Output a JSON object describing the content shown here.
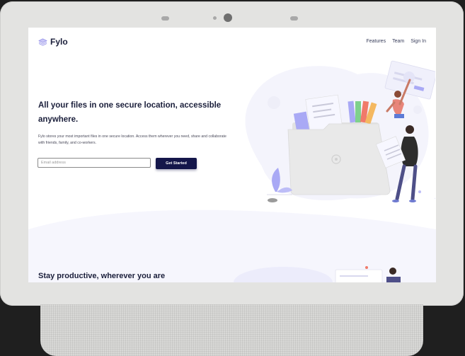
{
  "header": {
    "logo_text": "Fylo",
    "nav": [
      {
        "label": "Features"
      },
      {
        "label": "Team"
      },
      {
        "label": "Sign In"
      }
    ]
  },
  "hero": {
    "title": "All your files in one secure location, accessible anywhere.",
    "description": "Fylo stores your most important files in one secure location. Access them wherever you need, share and collaborate with friends, family, and co-workers.",
    "email_placeholder": "Email address",
    "cta_label": "Get Started"
  },
  "features": {
    "section_title": "Stay productive, wherever you are"
  },
  "colors": {
    "primary": "#14164a",
    "text": "#1b1f3b",
    "accent_lavender": "#a9a9f5",
    "bg_light": "#f4f4fc"
  }
}
